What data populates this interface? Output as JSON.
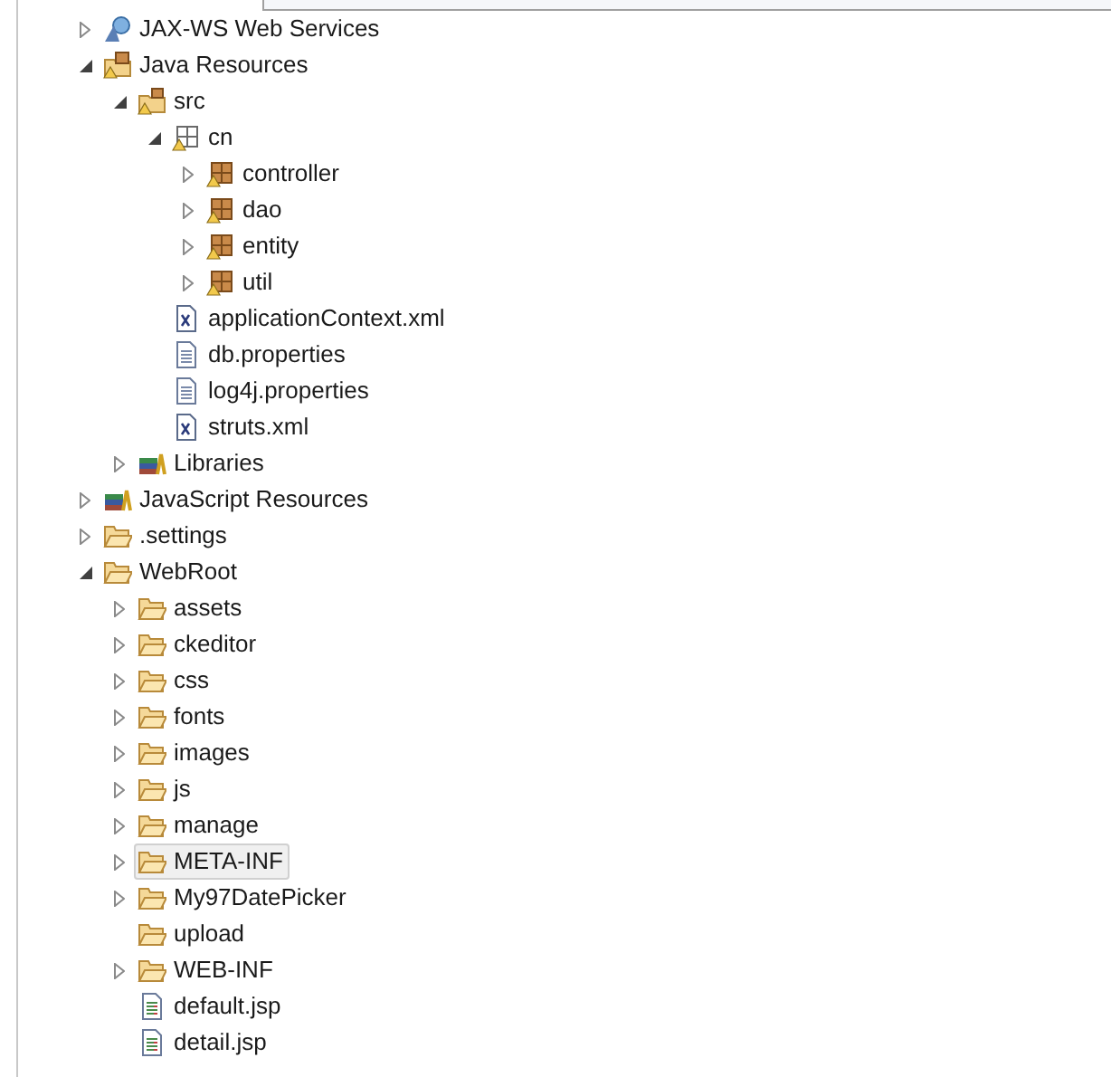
{
  "tree": [
    {
      "label": "JAX-WS Web Services",
      "kind": "web-services",
      "expanded": false,
      "selected": false
    },
    {
      "label": "Java Resources",
      "kind": "java-resources",
      "expanded": true,
      "selected": false,
      "children": [
        {
          "label": "src",
          "kind": "source-folder",
          "expanded": true,
          "selected": false,
          "children": [
            {
              "label": "cn",
              "kind": "package-root",
              "expanded": true,
              "selected": false,
              "children": [
                {
                  "label": "controller",
                  "kind": "package",
                  "expanded": false,
                  "selected": false
                },
                {
                  "label": "dao",
                  "kind": "package",
                  "expanded": false,
                  "selected": false
                },
                {
                  "label": "entity",
                  "kind": "package",
                  "expanded": false,
                  "selected": false
                },
                {
                  "label": "util",
                  "kind": "package",
                  "expanded": false,
                  "selected": false
                }
              ]
            },
            {
              "label": "applicationContext.xml",
              "kind": "xml-file",
              "selected": false
            },
            {
              "label": "db.properties",
              "kind": "text-file",
              "selected": false
            },
            {
              "label": "log4j.properties",
              "kind": "text-file",
              "selected": false
            },
            {
              "label": "struts.xml",
              "kind": "xml-file",
              "selected": false
            }
          ]
        },
        {
          "label": "Libraries",
          "kind": "libraries",
          "expanded": false,
          "selected": false
        }
      ]
    },
    {
      "label": "JavaScript Resources",
      "kind": "libraries",
      "expanded": false,
      "selected": false
    },
    {
      "label": ".settings",
      "kind": "folder",
      "expanded": false,
      "selected": false
    },
    {
      "label": "WebRoot",
      "kind": "folder",
      "expanded": true,
      "selected": false,
      "children": [
        {
          "label": "assets",
          "kind": "folder",
          "expanded": false,
          "selected": false
        },
        {
          "label": "ckeditor",
          "kind": "folder",
          "expanded": false,
          "selected": false
        },
        {
          "label": "css",
          "kind": "folder",
          "expanded": false,
          "selected": false
        },
        {
          "label": "fonts",
          "kind": "folder",
          "expanded": false,
          "selected": false
        },
        {
          "label": "images",
          "kind": "folder",
          "expanded": false,
          "selected": false
        },
        {
          "label": "js",
          "kind": "folder",
          "expanded": false,
          "selected": false
        },
        {
          "label": "manage",
          "kind": "folder",
          "expanded": false,
          "selected": false
        },
        {
          "label": "META-INF",
          "kind": "folder",
          "expanded": false,
          "selected": true
        },
        {
          "label": "My97DatePicker",
          "kind": "folder",
          "expanded": false,
          "selected": false
        },
        {
          "label": "upload",
          "kind": "folder",
          "selected": false
        },
        {
          "label": "WEB-INF",
          "kind": "folder",
          "expanded": false,
          "selected": false
        },
        {
          "label": "default.jsp",
          "kind": "jsp-file",
          "selected": false
        },
        {
          "label": "detail.jsp",
          "kind": "jsp-file",
          "selected": false
        }
      ]
    }
  ]
}
